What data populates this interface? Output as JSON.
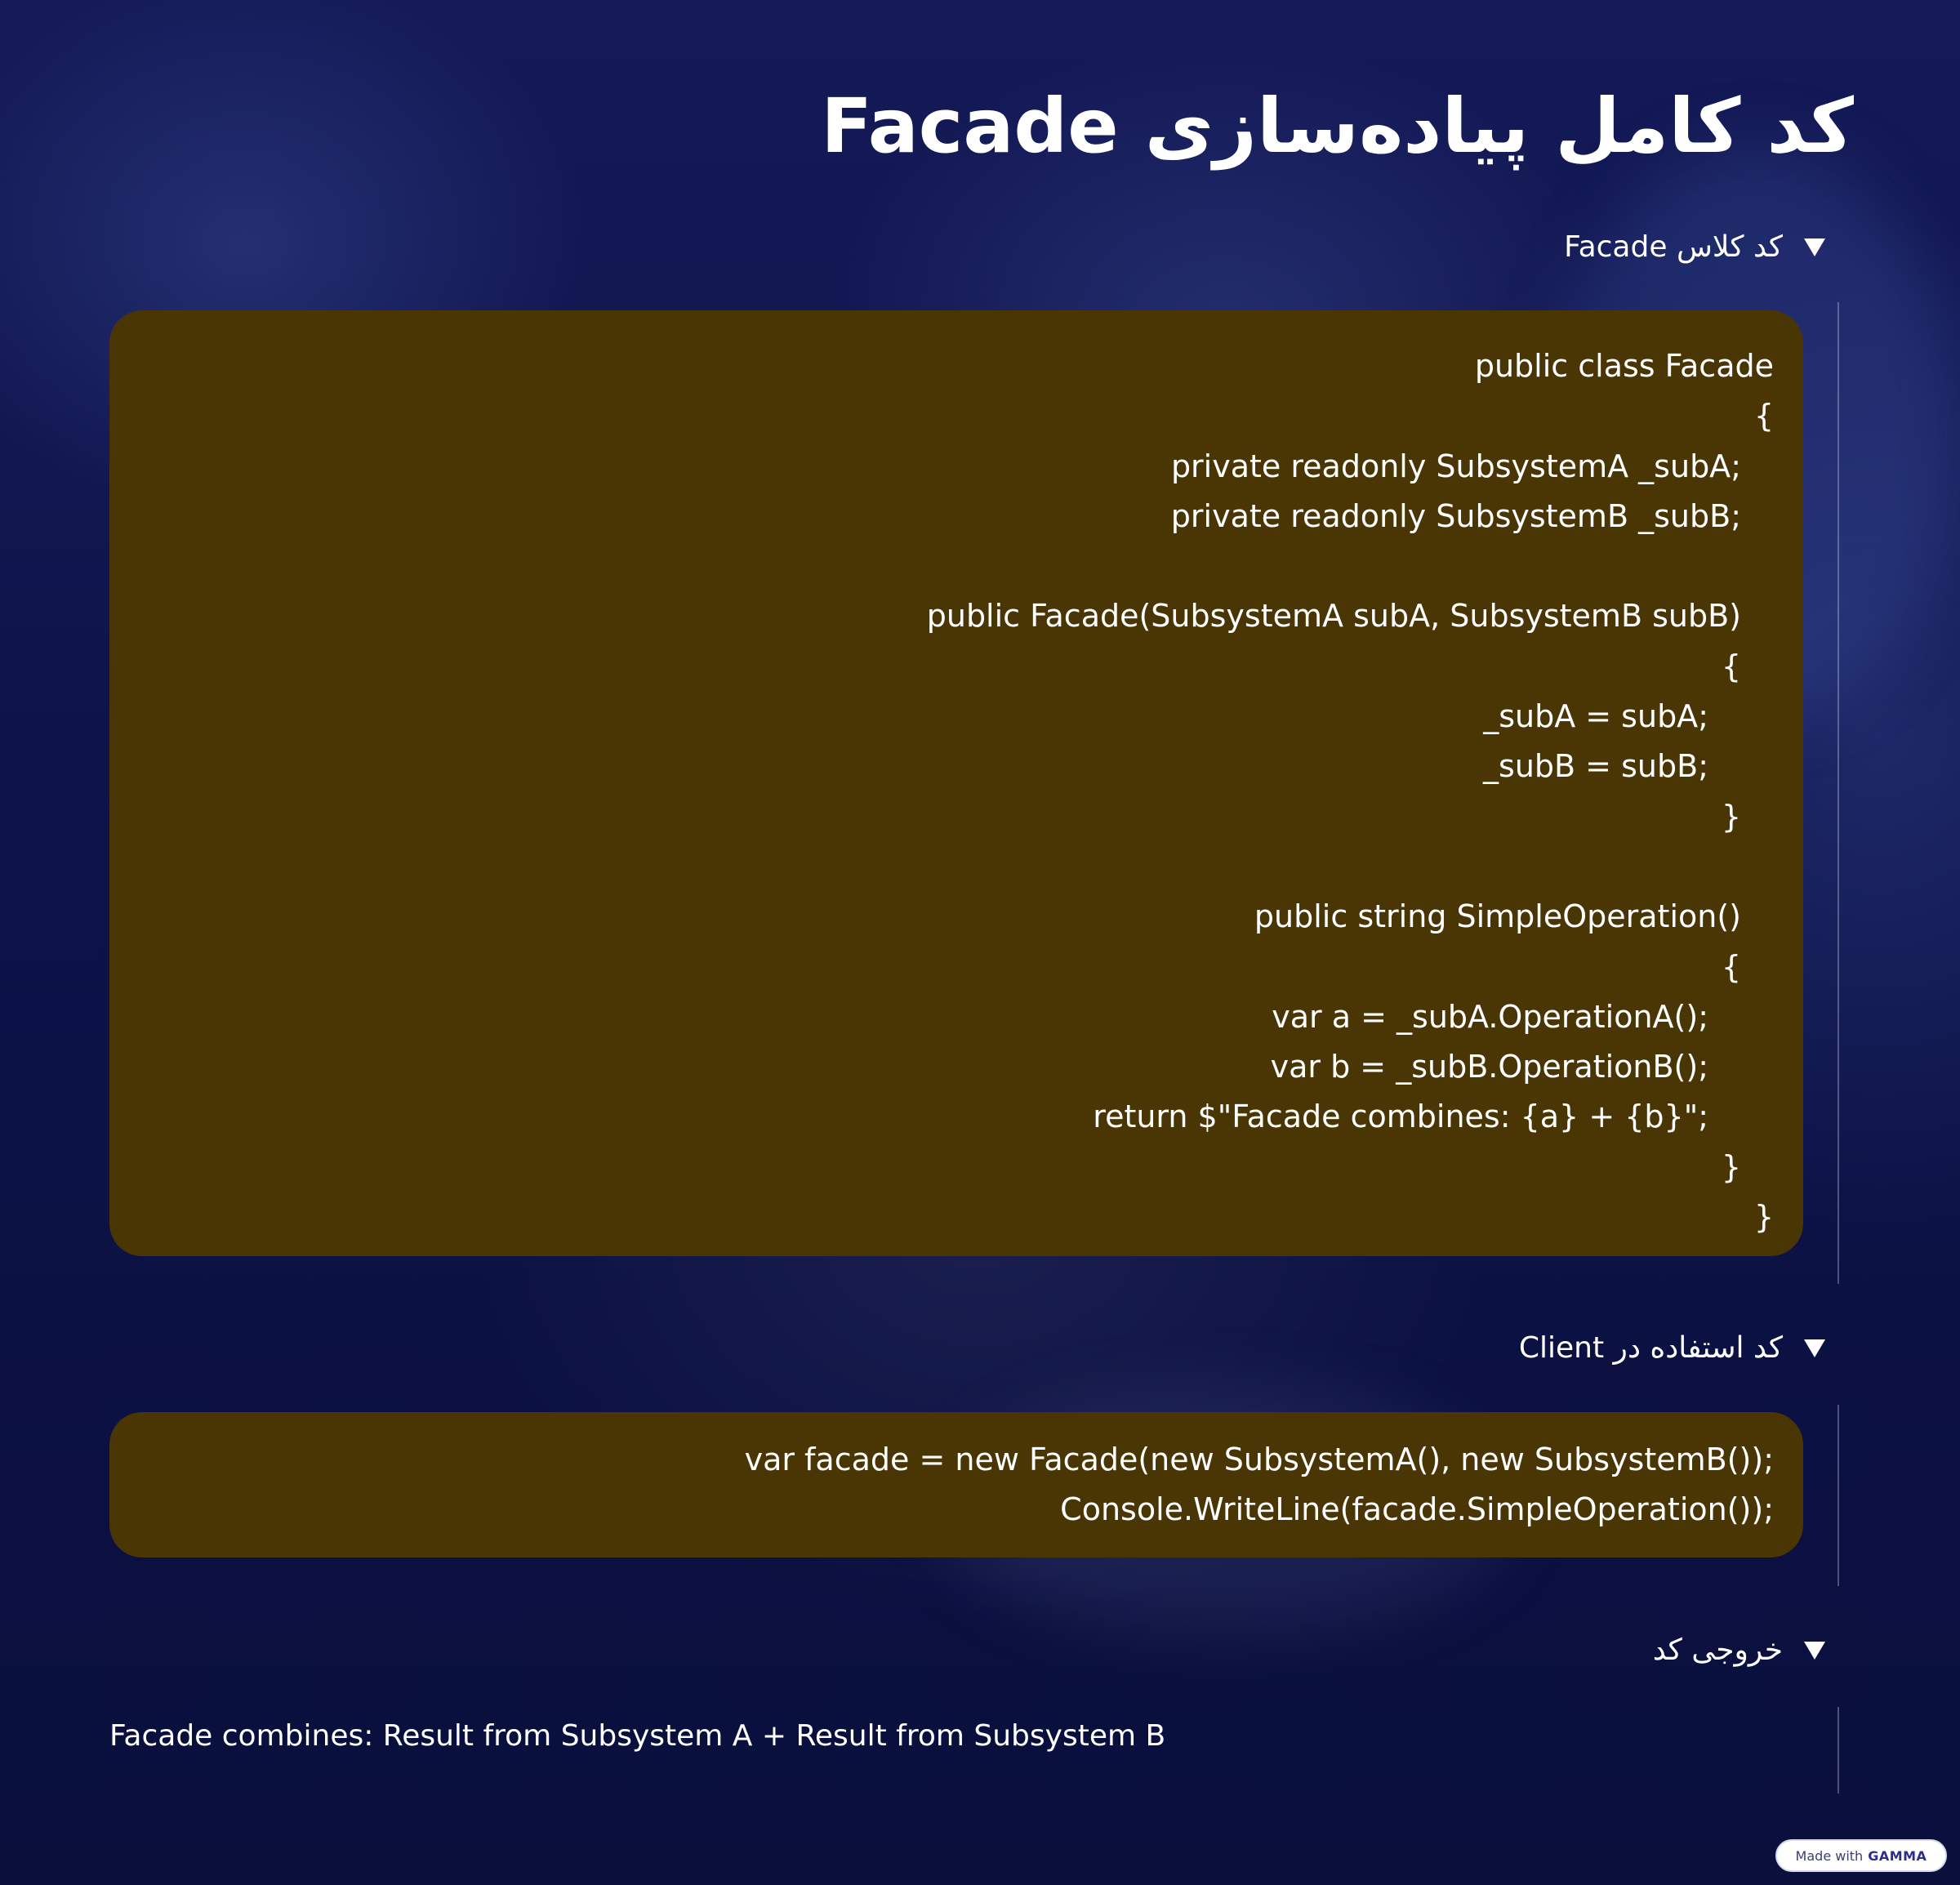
{
  "title": "کد کامل پیاده‌سازی Facade",
  "sections": [
    {
      "header": "کد کلاس Facade",
      "code": [
        {
          "text": "public class Facade",
          "indent": 0
        },
        {
          "text": "}",
          "indent": 0
        },
        {
          "text": ";private readonly SubsystemA _subA",
          "indent": 1
        },
        {
          "text": ";private readonly SubsystemB _subB",
          "indent": 1
        },
        {
          "text": "",
          "indent": 1
        },
        {
          "text": "public Facade(SubsystemA subA, SubsystemB subB)",
          "indent": 1
        },
        {
          "text": "}",
          "indent": 1
        },
        {
          "text": ";subA = subA_",
          "indent": 2
        },
        {
          "text": ";subB = subB_",
          "indent": 2
        },
        {
          "text": "{",
          "indent": 1
        },
        {
          "text": "",
          "indent": 1
        },
        {
          "text": "()public string SimpleOperation",
          "indent": 1
        },
        {
          "text": "}",
          "indent": 1
        },
        {
          "text": ";()var a = _subA.OperationA",
          "indent": 2
        },
        {
          "text": ";()var b = _subB.OperationB",
          "indent": 2
        },
        {
          "text": ";\"return $\"Facade combines: {a} + {b}",
          "indent": 2
        },
        {
          "text": "{",
          "indent": 1
        },
        {
          "text": "{",
          "indent": 0
        }
      ]
    },
    {
      "header": "کد استفاده در Client",
      "code": [
        {
          "text": ";var facade = new Facade(new SubsystemA(), new SubsystemB())",
          "indent": 0
        },
        {
          "text": ";Console.WriteLine(facade.SimpleOperation())",
          "indent": 0
        }
      ]
    },
    {
      "header": "خروجی کد",
      "output": "Facade combines: Result from Subsystem A + Result from Subsystem B"
    }
  ],
  "badge": {
    "prefix": "Made with",
    "brand": "GAMMA"
  }
}
